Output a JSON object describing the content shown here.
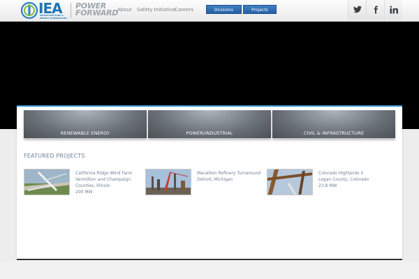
{
  "header": {
    "logo_text": "IEA",
    "logo_subtext": "INFRASTRUCTURE & ENERGY ALTERNATIVES",
    "tagline_line1": "POWER",
    "tagline_line2": "FORWARD",
    "nav": [
      "About",
      "Safety Initiative",
      "Careers"
    ],
    "buttons": {
      "divisions": "Divisions",
      "projects": "Projects"
    },
    "social": [
      "twitter-icon",
      "facebook-icon",
      "linkedin-icon"
    ],
    "accent_color": "#1d75b8"
  },
  "divisions": [
    "RENEWABLE ENERGY",
    "POWER/INDUSTRIAL",
    "CIVIL & INFRASTRUCTURE"
  ],
  "featured": {
    "title": "FEATURED PROJECTS",
    "projects": [
      {
        "name": "California Ridge Wind Farm",
        "location_line1": "Vermillion and Champaign",
        "location_line2": "Counties, Illinois",
        "capacity": "200 MW"
      },
      {
        "name": "Marathon Refinery Turnaround",
        "location_line1": "Detroit, Michigan",
        "location_line2": "",
        "capacity": ""
      },
      {
        "name": "Colorado Highlands II",
        "location_line1": "Logan County, Colorado",
        "location_line2": "",
        "capacity": "23.8 MW"
      }
    ]
  }
}
